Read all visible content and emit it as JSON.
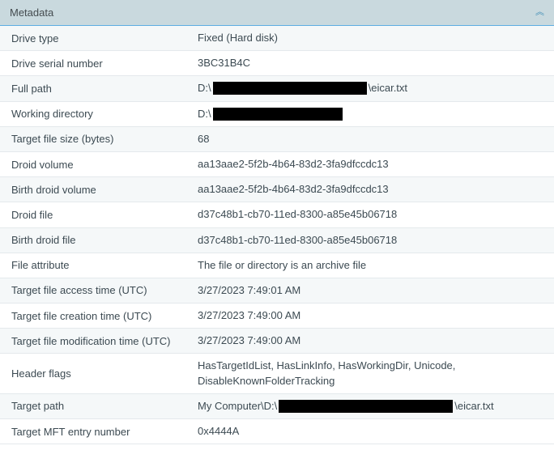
{
  "panel": {
    "title": "Metadata"
  },
  "rows": {
    "drive_type": {
      "label": "Drive type",
      "value": "Fixed (Hard disk)"
    },
    "drive_serial": {
      "label": "Drive serial number",
      "value": "3BC31B4C"
    },
    "full_path": {
      "label": "Full path",
      "prefix": "D:\\",
      "suffix": "\\eicar.txt"
    },
    "working_dir": {
      "label": "Working directory",
      "prefix": "D:\\"
    },
    "target_size": {
      "label": "Target file size (bytes)",
      "value": "68"
    },
    "droid_volume": {
      "label": "Droid volume",
      "value": "aa13aae2-5f2b-4b64-83d2-3fa9dfccdc13"
    },
    "birth_droid_volume": {
      "label": "Birth droid volume",
      "value": "aa13aae2-5f2b-4b64-83d2-3fa9dfccdc13"
    },
    "droid_file": {
      "label": "Droid file",
      "value": "d37c48b1-cb70-11ed-8300-a85e45b06718"
    },
    "birth_droid_file": {
      "label": "Birth droid file",
      "value": "d37c48b1-cb70-11ed-8300-a85e45b06718"
    },
    "file_attribute": {
      "label": "File attribute",
      "value": "The file or directory is an archive file"
    },
    "access_time": {
      "label": "Target file access time (UTC)",
      "value": "3/27/2023 7:49:01 AM"
    },
    "creation_time": {
      "label": "Target file creation time (UTC)",
      "value": "3/27/2023 7:49:00 AM"
    },
    "modification_time": {
      "label": "Target file modification time (UTC)",
      "value": "3/27/2023 7:49:00 AM"
    },
    "header_flags": {
      "label": "Header flags",
      "value": "HasTargetIdList, HasLinkInfo, HasWorkingDir, Unicode, DisableKnownFolderTracking"
    },
    "target_path": {
      "label": "Target path",
      "prefix": "My Computer\\D:\\",
      "suffix": "\\eicar.txt"
    },
    "target_mft": {
      "label": "Target MFT entry number",
      "value": "0x4444A"
    }
  }
}
